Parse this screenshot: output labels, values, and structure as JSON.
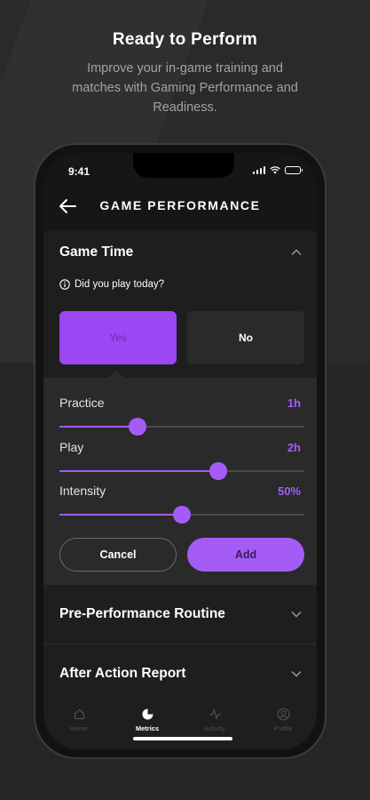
{
  "promo": {
    "title": "Ready to Perform",
    "subtitle": "Improve your in-game training and matches with Gaming Performance and Readiness."
  },
  "status_bar": {
    "time": "9:41"
  },
  "header": {
    "title": "GAME PERFORMANCE",
    "back_icon": "arrow-left-icon"
  },
  "game_time": {
    "title": "Game Time",
    "expanded": true,
    "question": "Did you play today?",
    "options": [
      {
        "label": "Yes",
        "selected": true
      },
      {
        "label": "No",
        "selected": false
      }
    ]
  },
  "sliders": [
    {
      "label": "Practice",
      "value": "1h",
      "fraction": 0.32
    },
    {
      "label": "Play",
      "value": "2h",
      "fraction": 0.65
    },
    {
      "label": "Intensity",
      "value": "50%",
      "fraction": 0.5
    }
  ],
  "actions": {
    "cancel": "Cancel",
    "add": "Add"
  },
  "sections": [
    {
      "title": "Pre-Performance Routine",
      "expanded": false
    },
    {
      "title": "After Action Report",
      "expanded": false
    }
  ],
  "tabs": [
    {
      "label": "Home",
      "icon": "home-icon",
      "active": false
    },
    {
      "label": "Metrics",
      "icon": "metrics-icon",
      "active": true
    },
    {
      "label": "Activity",
      "icon": "activity-icon",
      "active": false
    },
    {
      "label": "Profile",
      "icon": "profile-icon",
      "active": false
    }
  ],
  "colors": {
    "accent": "#a55cf7",
    "background": "#2a2a2b",
    "card": "#1e1e1f"
  }
}
